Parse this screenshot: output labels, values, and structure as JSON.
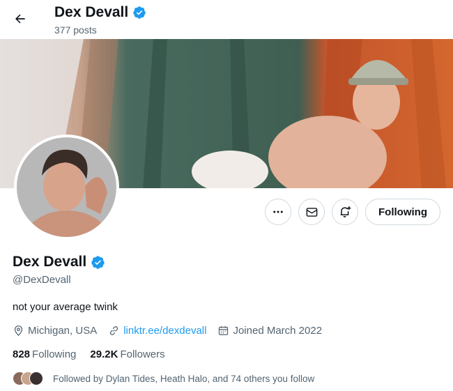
{
  "header": {
    "title": "Dex Devall",
    "posts": "377 posts"
  },
  "profile": {
    "display_name": "Dex Devall",
    "handle": "@DexDevall",
    "bio": "not your average twink",
    "location": "Michigan, USA",
    "link": "linktr.ee/dexdevall",
    "joined": "Joined March 2022",
    "verified": true
  },
  "actions": {
    "follow_label": "Following"
  },
  "stats": {
    "following_count": "828",
    "following_label": "Following",
    "followers_count": "29.2K",
    "followers_label": "Followers"
  },
  "followed_by": "Followed by Dylan Tides, Heath Halo, and 74 others you follow",
  "colors": {
    "accent": "#1d9bf0",
    "secondary_text": "#536471",
    "border": "#cfd9de"
  },
  "icons": [
    "back-arrow-icon",
    "verified-badge-icon",
    "more-icon",
    "message-icon",
    "notification-bell-icon",
    "location-icon",
    "link-icon",
    "calendar-icon"
  ]
}
